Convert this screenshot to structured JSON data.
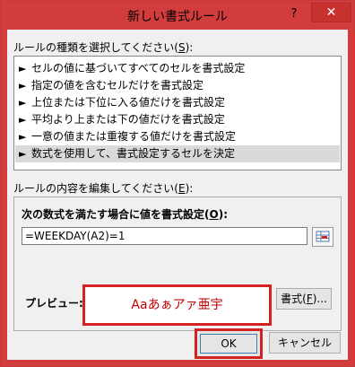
{
  "window": {
    "title": "新しい書式ルール",
    "help": "?",
    "close": "✕"
  },
  "rule_type": {
    "label": "ルールの種類を選択してください(",
    "mnemonic": "S",
    "label_end": "):",
    "items": [
      {
        "label": "セルの値に基づいてすべてのセルを書式設定",
        "selected": false
      },
      {
        "label": "指定の値を含むセルだけを書式設定",
        "selected": false
      },
      {
        "label": "上位または下位に入る値だけを書式設定",
        "selected": false
      },
      {
        "label": "平均より上または下の値だけを書式設定",
        "selected": false
      },
      {
        "label": "一意の値または重複する値だけを書式設定",
        "selected": false
      },
      {
        "label": "数式を使用して、書式設定するセルを決定",
        "selected": true
      }
    ],
    "arrow_glyph": "►"
  },
  "rule_content": {
    "label": "ルールの内容を編集してください(",
    "mnemonic": "E",
    "label_end": "):",
    "formula_title": "次の数式を満たす場合に値を書式設定(",
    "formula_mnemonic": "O",
    "formula_title_end": "):",
    "formula_value": "=WEEKDAY(A2)=1",
    "preview_label": "プレビュー:",
    "preview_text": "Aaあぁアァ亜宇",
    "format_button": "書式(",
    "format_mnemonic": "F",
    "format_button_end": ")..."
  },
  "buttons": {
    "ok": "OK",
    "cancel": "キャンセル"
  },
  "colors": {
    "titlebar": "#d33c3c",
    "highlight_border": "#d42121",
    "preview_text": "#c00000"
  }
}
